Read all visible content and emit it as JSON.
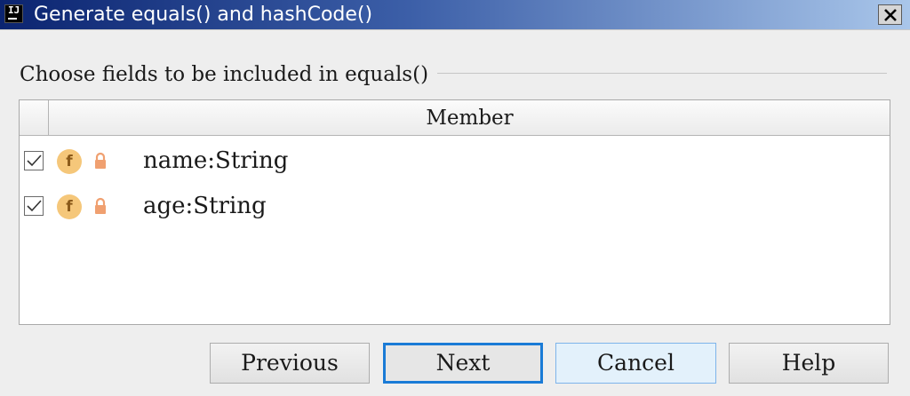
{
  "window": {
    "title": "Generate equals() and hashCode()",
    "app_icon_text": "IJ"
  },
  "section": {
    "label": "Choose fields to be included in equals()"
  },
  "table": {
    "column_header": "Member",
    "rows": [
      {
        "label": "name:String",
        "checked": true,
        "icon": "field-icon",
        "icon_text": "f"
      },
      {
        "label": "age:String",
        "checked": true,
        "icon": "field-icon",
        "icon_text": "f"
      }
    ]
  },
  "buttons": {
    "previous": "Previous",
    "next": "Next",
    "cancel": "Cancel",
    "help": "Help"
  },
  "colors": {
    "titlebar_start": "#0b2470",
    "titlebar_end": "#a9c6ea",
    "focus_border": "#1a7bd6",
    "field_icon": "#f5c77a",
    "lock_icon": "#f0a070"
  }
}
